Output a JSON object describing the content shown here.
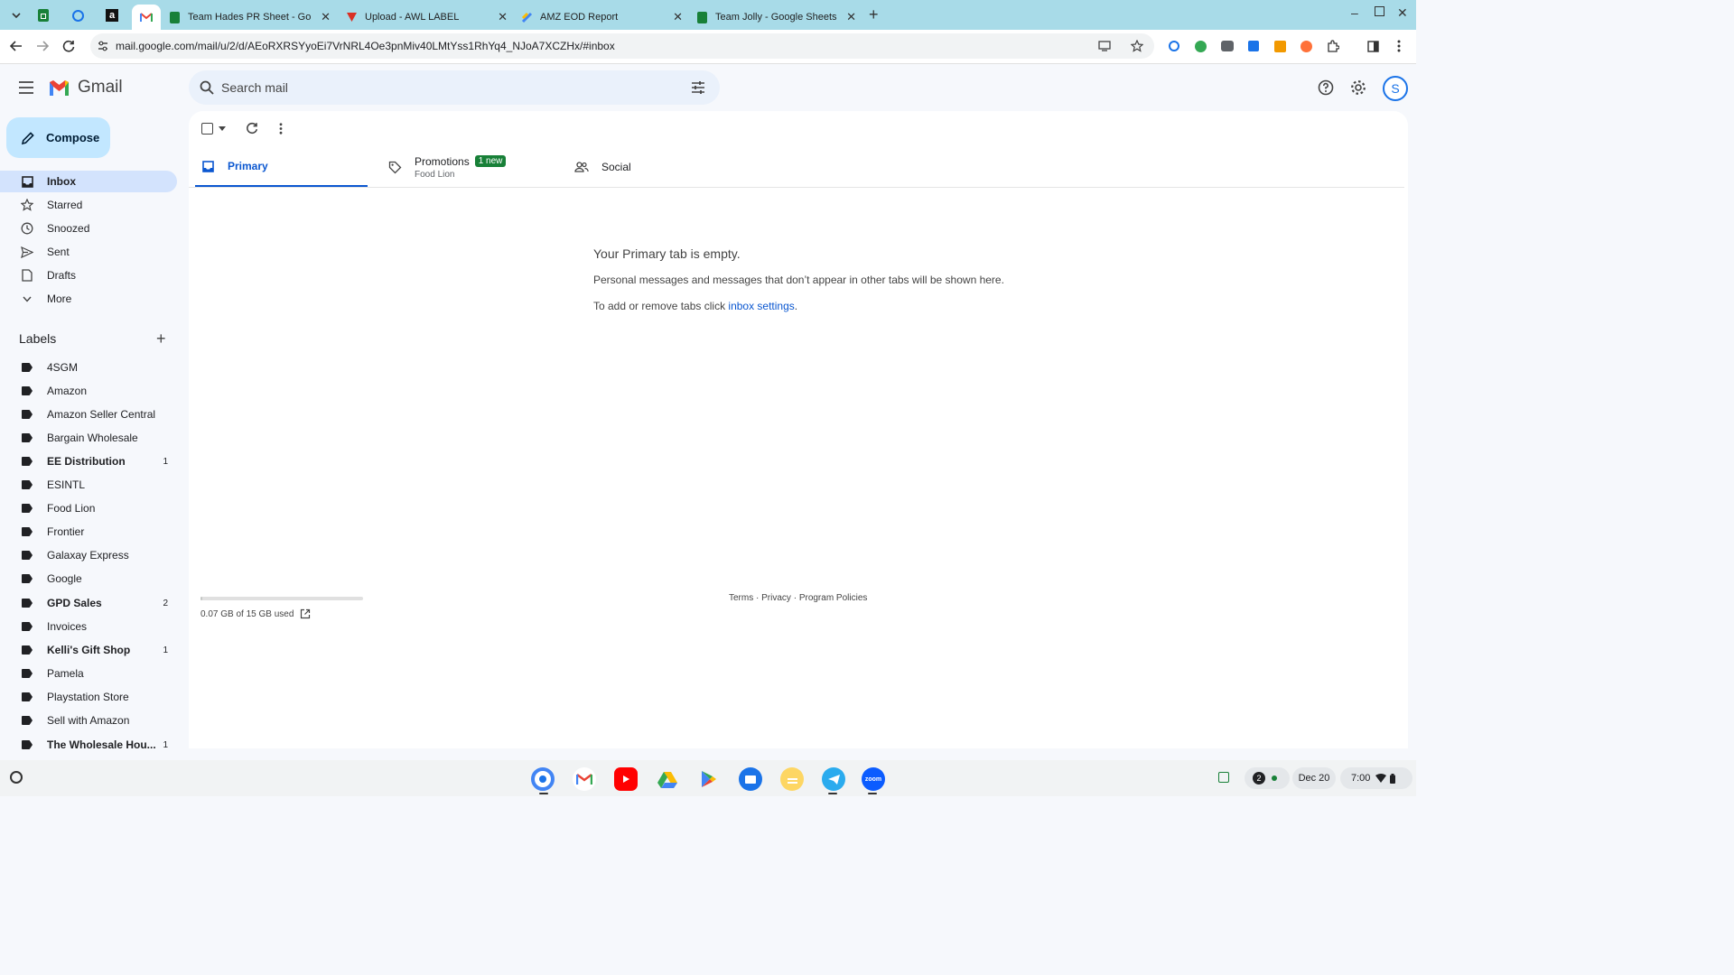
{
  "browser": {
    "tabs": [
      {
        "title": "Team Hades PR Sheet - Google"
      },
      {
        "title": "Upload - AWL LABEL"
      },
      {
        "title": "AMZ EOD Report"
      },
      {
        "title": "Team Jolly - Google Sheets"
      }
    ],
    "pinned_icons": [
      "sheets-icon",
      "puzzle-icon",
      "amazon-icon",
      "gmail-icon"
    ],
    "url": "mail.google.com/mail/u/2/d/AEoRXRSYyoEi7VrNRL4Oe3pnMiv40LMtYss1RhYq4_NJoA7XCZHx/#inbox"
  },
  "gmail": {
    "app_name": "Gmail",
    "search_placeholder": "Search mail",
    "avatar_letter": "S",
    "compose_label": "Compose",
    "nav": [
      {
        "label": "Inbox",
        "icon": "inbox-icon",
        "active": true
      },
      {
        "label": "Starred",
        "icon": "star-icon"
      },
      {
        "label": "Snoozed",
        "icon": "clock-icon"
      },
      {
        "label": "Sent",
        "icon": "send-icon"
      },
      {
        "label": "Drafts",
        "icon": "draft-icon"
      },
      {
        "label": "More",
        "icon": "chevron-down-icon"
      }
    ],
    "labels_heading": "Labels",
    "labels": [
      {
        "name": "4SGM",
        "count": ""
      },
      {
        "name": "Amazon",
        "count": ""
      },
      {
        "name": "Amazon Seller Central",
        "count": ""
      },
      {
        "name": "Bargain Wholesale",
        "count": ""
      },
      {
        "name": "EE Distribution",
        "count": "1"
      },
      {
        "name": "ESINTL",
        "count": ""
      },
      {
        "name": "Food Lion",
        "count": ""
      },
      {
        "name": "Frontier",
        "count": ""
      },
      {
        "name": "Galaxay Express",
        "count": ""
      },
      {
        "name": "Google",
        "count": ""
      },
      {
        "name": "GPD Sales",
        "count": "2"
      },
      {
        "name": "Invoices",
        "count": ""
      },
      {
        "name": "Kelli's Gift Shop",
        "count": "1"
      },
      {
        "name": "Pamela",
        "count": ""
      },
      {
        "name": "Playstation Store",
        "count": ""
      },
      {
        "name": "Sell with Amazon",
        "count": ""
      },
      {
        "name": "The Wholesale Hou...",
        "count": "1"
      }
    ],
    "category_tabs": {
      "primary": "Primary",
      "promotions": "Promotions",
      "promotions_badge": "1 new",
      "promotions_sub": "Food Lion",
      "social": "Social"
    },
    "empty": {
      "title": "Your Primary tab is empty.",
      "line1": "Personal messages and messages that don’t appear in other tabs will be shown here.",
      "line2_prefix": "To add or remove tabs click ",
      "line2_link": "inbox settings",
      "line2_suffix": "."
    },
    "storage": {
      "text": "0.07 GB of 15 GB used",
      "fraction": 0.005
    },
    "footer": {
      "terms": "Terms",
      "sep": " · ",
      "privacy": "Privacy",
      "policies": "Program Policies"
    }
  },
  "shelf": {
    "date": "Dec 20",
    "time": "7:00",
    "notification_count": "2",
    "apps": [
      "chrome-icon",
      "gmail-icon",
      "youtube-icon",
      "drive-icon",
      "play-store-icon",
      "files-icon",
      "notes-icon",
      "telegram-icon",
      "zoom-icon"
    ],
    "zoom_label": "zoom"
  },
  "colors": {
    "tabstrip": "#a8dbe8",
    "accent": "#0b57d0",
    "compose": "#c2e7ff",
    "badge": "#188038"
  }
}
